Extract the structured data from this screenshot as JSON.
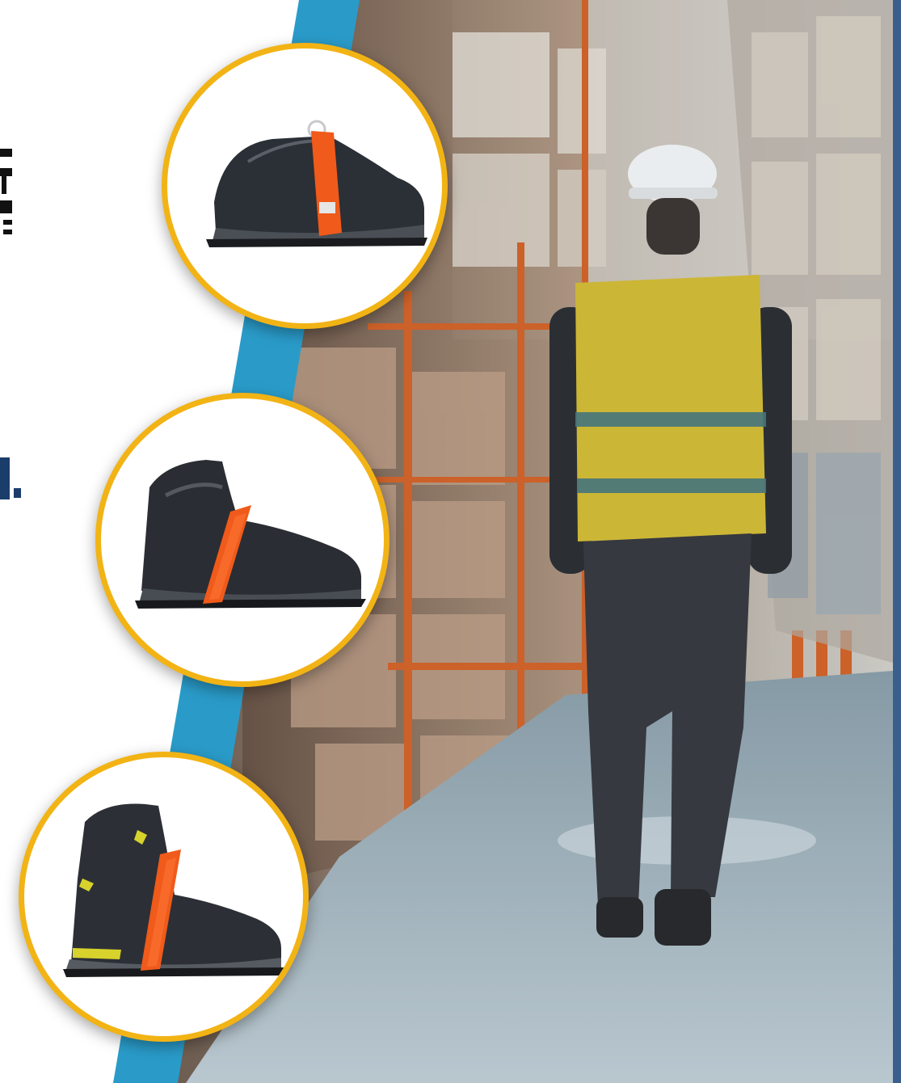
{
  "scene": {
    "background": "#ffffff",
    "accent_stripe": "#2a9bc9",
    "circle_border": "#f2b315",
    "frame_right": "#3a5f8c"
  },
  "products": [
    {
      "icon": "low-cut-safety-sneaker-icon",
      "strap_color": "#f05a1a"
    },
    {
      "icon": "mid-cut-safety-shoe-icon",
      "strap_color": "#f05a1a"
    },
    {
      "icon": "high-cut-safety-boot-icon",
      "strap_color": "#f05a1a"
    }
  ],
  "photo": {
    "icon": "warehouse-worker-photo"
  }
}
